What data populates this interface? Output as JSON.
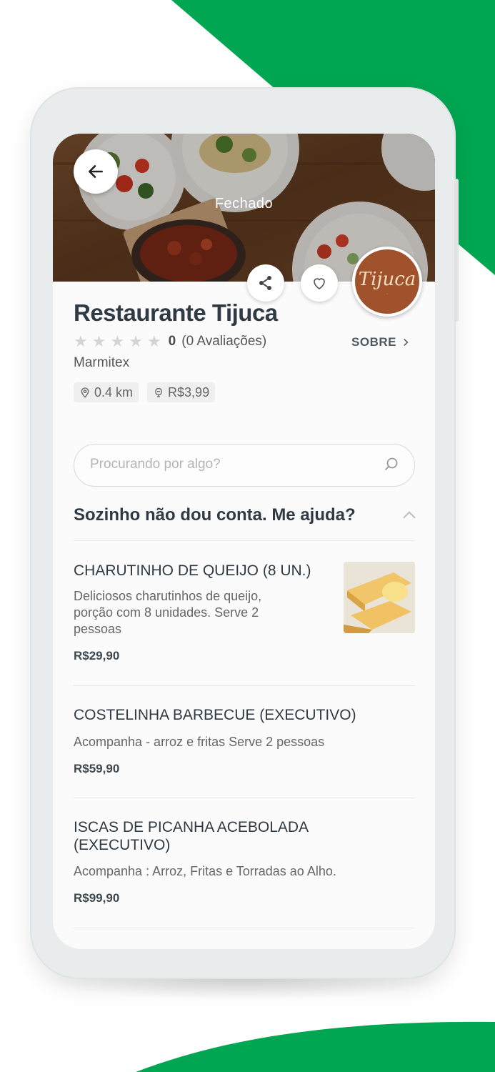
{
  "colors": {
    "brand_green": "#00a651",
    "text_dark": "#2f3a45"
  },
  "restaurant": {
    "status": "Fechado",
    "name": "Restaurante Tijuca",
    "logo_text": "Tijuca",
    "rating_value": "0",
    "rating_count": "(0 Avaliações)",
    "rating_stars": 0,
    "about_label": "SOBRE",
    "category": "Marmitex",
    "distance": "0.4 km",
    "delivery_fee": "R$3,99"
  },
  "search": {
    "placeholder": "Procurando por algo?"
  },
  "section": {
    "title": "Sozinho não dou conta. Me ajuda?"
  },
  "menu_items": [
    {
      "name": "CHARUTINHO DE QUEIJO (8 UN.)",
      "description": "Deliciosos charutinhos de queijo, porção com 8 unidades. Serve 2 pessoas",
      "price": "R$29,90"
    },
    {
      "name": "COSTELINHA BARBECUE (EXECUTIVO)",
      "description": "Acompanha - arroz e fritas Serve 2 pessoas",
      "price": "R$59,90"
    },
    {
      "name": "ISCAS DE PICANHA ACEBOLADA (EXECUTIVO)",
      "description": "Acompanha : Arroz, Fritas e Torradas ao Alho.",
      "price": "R$99,90"
    }
  ],
  "icons": [
    "arrow-left-icon",
    "share-icon",
    "heart-icon",
    "star-icon",
    "chevron-right-icon",
    "location-pin-icon",
    "delivery-fee-icon",
    "search-icon",
    "chevron-up-icon"
  ]
}
